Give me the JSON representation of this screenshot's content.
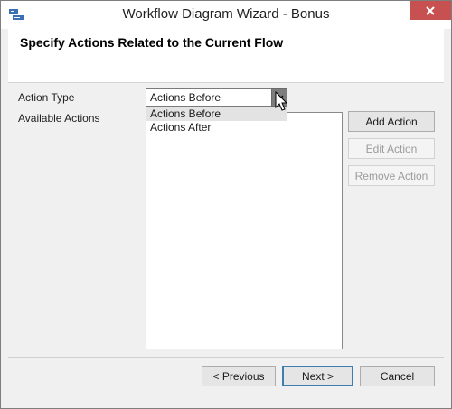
{
  "window": {
    "title": "Workflow Diagram Wizard - Bonus",
    "close_icon": "close-icon"
  },
  "header": {
    "title": "Specify Actions Related to the Current Flow"
  },
  "form": {
    "action_type_label": "Action Type",
    "available_actions_label": "Available Actions",
    "action_type_value": "Actions Before",
    "action_type_options": [
      "Actions Before",
      "Actions After"
    ]
  },
  "actions": {
    "add_label": "Add Action",
    "edit_label": "Edit Action",
    "remove_label": "Remove Action"
  },
  "footer": {
    "previous_label": "< Previous",
    "next_label": "Next >",
    "cancel_label": "Cancel"
  },
  "colors": {
    "close_button": "#c75050",
    "dropdown_selected": "#e3e3e3",
    "default_button_border": "#3c7fb1"
  }
}
